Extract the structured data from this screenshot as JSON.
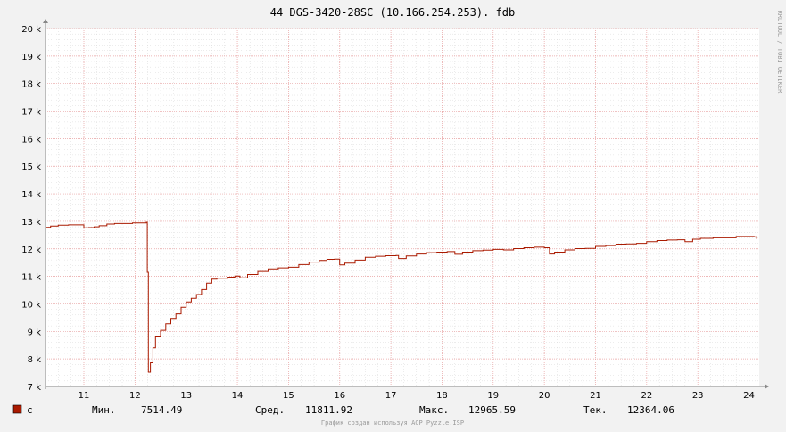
{
  "chart_data": {
    "type": "line",
    "title": "44 DGS-3420-28SC (10.166.254.253). fdb",
    "xlabel": "",
    "ylabel": "",
    "x_ticks": [
      "11",
      "12",
      "13",
      "14",
      "15",
      "16",
      "17",
      "18",
      "19",
      "20",
      "21",
      "22",
      "23",
      "24"
    ],
    "y_ticks": [
      "7 k",
      "8 k",
      "9 k",
      "10 k",
      "11 k",
      "12 k",
      "13 k",
      "14 k",
      "15 k",
      "16 k",
      "17 k",
      "18 k",
      "19 k",
      "20 k"
    ],
    "xlim": [
      10.25,
      24.2
    ],
    "ylim": [
      7000,
      20000
    ],
    "grid": true,
    "series": [
      {
        "name": "c",
        "color": "#aa1a00",
        "points": [
          [
            10.25,
            12780
          ],
          [
            10.35,
            12830
          ],
          [
            10.5,
            12860
          ],
          [
            10.7,
            12870
          ],
          [
            10.95,
            12870
          ],
          [
            11.0,
            12760
          ],
          [
            11.1,
            12770
          ],
          [
            11.2,
            12800
          ],
          [
            11.3,
            12840
          ],
          [
            11.45,
            12900
          ],
          [
            11.6,
            12920
          ],
          [
            11.8,
            12920
          ],
          [
            11.95,
            12940
          ],
          [
            12.2,
            12940
          ],
          [
            12.22,
            12966
          ],
          [
            12.24,
            11150
          ],
          [
            12.26,
            7520
          ],
          [
            12.3,
            7860
          ],
          [
            12.35,
            8400
          ],
          [
            12.4,
            8800
          ],
          [
            12.5,
            9040
          ],
          [
            12.6,
            9280
          ],
          [
            12.7,
            9470
          ],
          [
            12.8,
            9640
          ],
          [
            12.9,
            9880
          ],
          [
            13.0,
            10070
          ],
          [
            13.1,
            10200
          ],
          [
            13.2,
            10340
          ],
          [
            13.3,
            10520
          ],
          [
            13.4,
            10750
          ],
          [
            13.5,
            10900
          ],
          [
            13.6,
            10930
          ],
          [
            13.8,
            10970
          ],
          [
            13.95,
            11010
          ],
          [
            14.05,
            10950
          ],
          [
            14.2,
            11070
          ],
          [
            14.4,
            11180
          ],
          [
            14.6,
            11270
          ],
          [
            14.8,
            11310
          ],
          [
            15.0,
            11330
          ],
          [
            15.2,
            11430
          ],
          [
            15.4,
            11520
          ],
          [
            15.6,
            11580
          ],
          [
            15.75,
            11620
          ],
          [
            15.9,
            11630
          ],
          [
            16.0,
            11420
          ],
          [
            16.1,
            11480
          ],
          [
            16.3,
            11590
          ],
          [
            16.5,
            11690
          ],
          [
            16.7,
            11730
          ],
          [
            16.9,
            11750
          ],
          [
            17.1,
            11760
          ],
          [
            17.15,
            11650
          ],
          [
            17.3,
            11740
          ],
          [
            17.5,
            11810
          ],
          [
            17.7,
            11860
          ],
          [
            17.9,
            11880
          ],
          [
            18.1,
            11900
          ],
          [
            18.25,
            11800
          ],
          [
            18.4,
            11880
          ],
          [
            18.6,
            11930
          ],
          [
            18.8,
            11950
          ],
          [
            19.0,
            11980
          ],
          [
            19.2,
            11960
          ],
          [
            19.4,
            12010
          ],
          [
            19.6,
            12040
          ],
          [
            19.8,
            12060
          ],
          [
            20.0,
            12040
          ],
          [
            20.1,
            11810
          ],
          [
            20.2,
            11880
          ],
          [
            20.4,
            11960
          ],
          [
            20.6,
            12010
          ],
          [
            20.8,
            12020
          ],
          [
            21.0,
            12090
          ],
          [
            21.2,
            12120
          ],
          [
            21.4,
            12170
          ],
          [
            21.6,
            12180
          ],
          [
            21.8,
            12200
          ],
          [
            22.0,
            12260
          ],
          [
            22.2,
            12300
          ],
          [
            22.4,
            12320
          ],
          [
            22.6,
            12330
          ],
          [
            22.7,
            12330
          ],
          [
            22.75,
            12260
          ],
          [
            22.9,
            12350
          ],
          [
            23.05,
            12380
          ],
          [
            23.3,
            12400
          ],
          [
            23.6,
            12400
          ],
          [
            23.75,
            12450
          ],
          [
            24.1,
            12440
          ],
          [
            24.15,
            12364
          ]
        ]
      }
    ]
  },
  "legend": {
    "series_label": "c",
    "min_label": "Мин.",
    "min_value": "7514.49",
    "avg_label": "Сред.",
    "avg_value": "11811.92",
    "max_label": "Макс.",
    "max_value": "12965.59",
    "cur_label": "Тек.",
    "cur_value": "12364.06"
  },
  "watermark": "RRDTOOL / TOBI OETIKER",
  "footer": "График создан используя ACP Pyzzle.ISP",
  "colors": {
    "background": "#f2f2f2",
    "plot_background": "#ffffff",
    "line": "#aa1a00",
    "major_grid": "#e8a0a0",
    "minor_grid": "#d8d8d8",
    "axis": "#888888"
  }
}
